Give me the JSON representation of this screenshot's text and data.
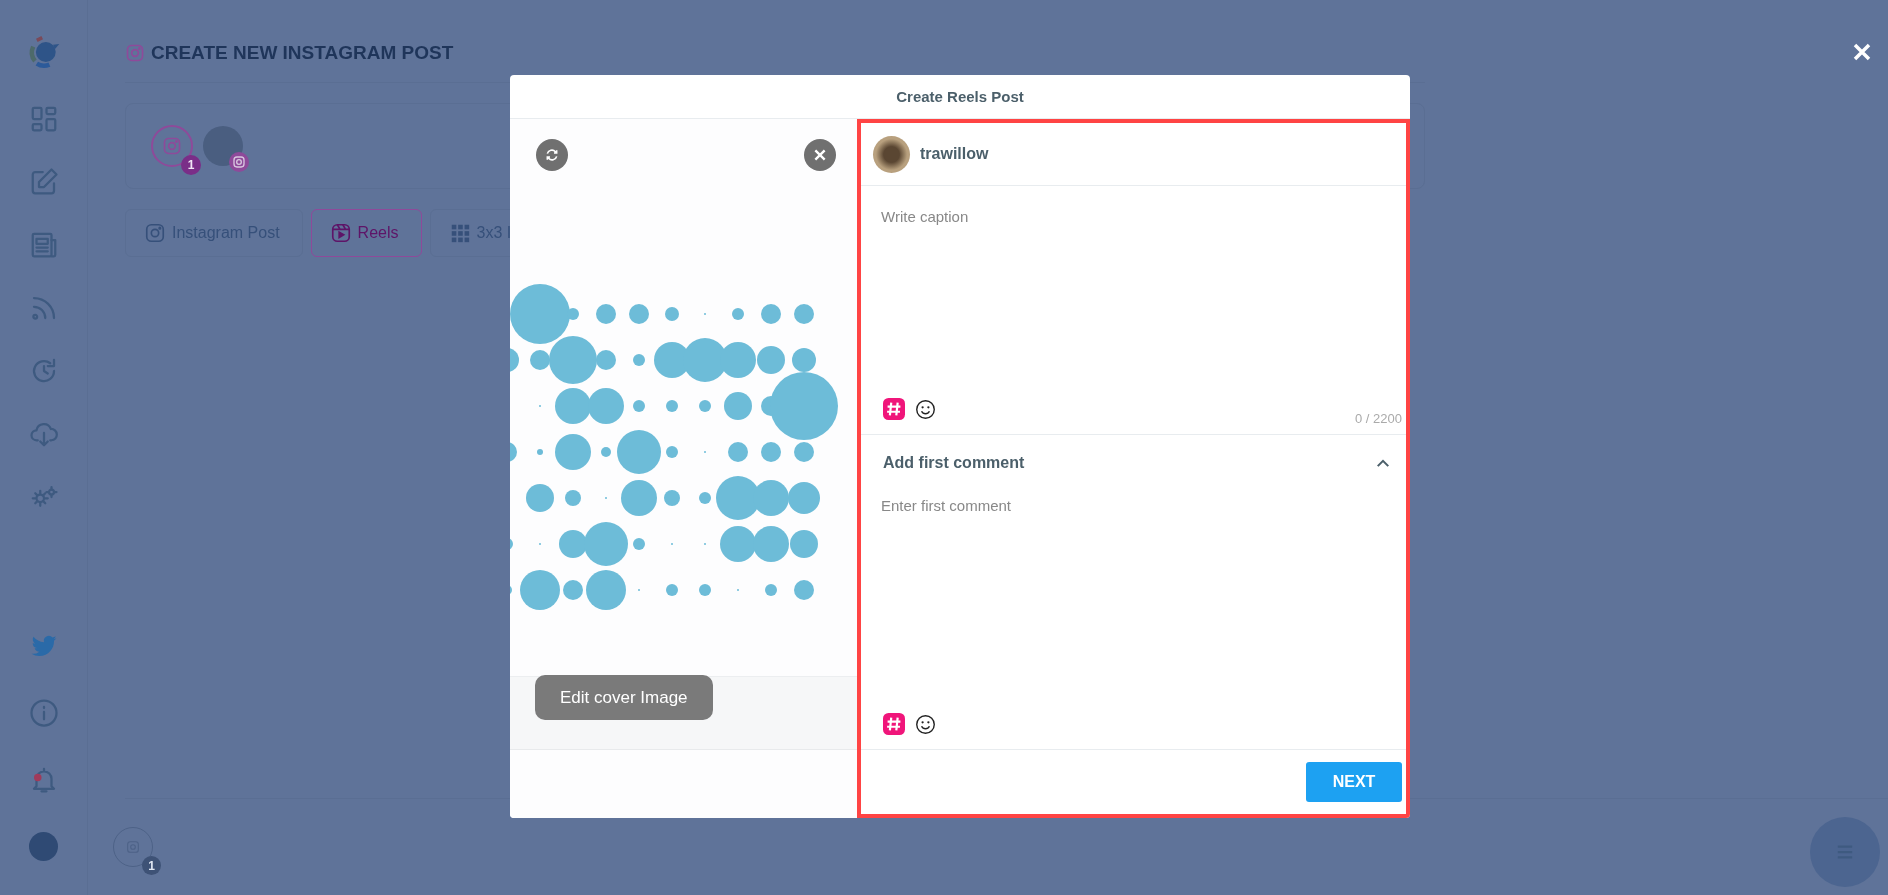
{
  "page": {
    "title": "CREATE NEW INSTAGRAM POST",
    "accounts": [
      {
        "kind": "network",
        "badge": "1"
      },
      {
        "kind": "avatar"
      }
    ],
    "post_types": [
      {
        "label": "Instagram Post",
        "selected": false
      },
      {
        "label": "Reels",
        "selected": true
      },
      {
        "label": "3x3 I",
        "selected": false
      }
    ],
    "queue_badge": "1"
  },
  "sidebar": {
    "notifications_unread": true
  },
  "modal": {
    "title": "Create Reels Post",
    "edit_cover_button": "Edit cover Image",
    "account": {
      "name": "trawillow"
    },
    "caption": {
      "placeholder": "Write caption",
      "counter": "0 / 2200"
    },
    "first_comment": {
      "title": "Add first comment",
      "expanded": true,
      "placeholder": "Enter first comment"
    },
    "next_button": "NEXT"
  }
}
